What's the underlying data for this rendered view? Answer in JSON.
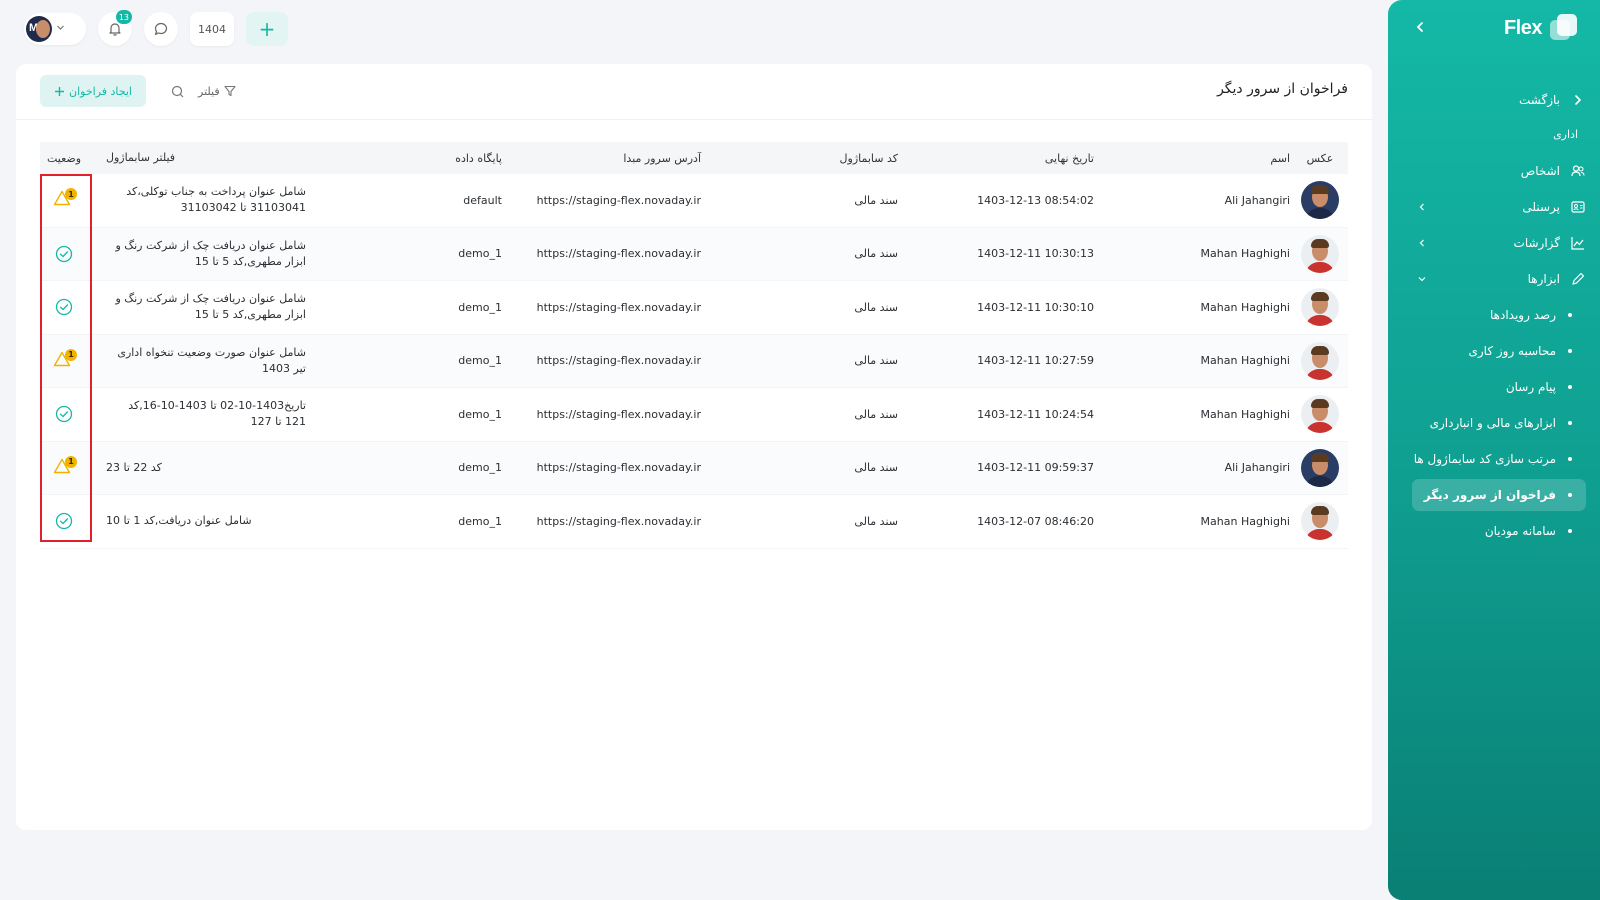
{
  "sidebar": {
    "brand": "Flex",
    "back_label": "بازگشت",
    "section_label": "اداری",
    "items": [
      {
        "label": "اشخاص",
        "icon": "people-icon"
      },
      {
        "label": "پرسنلی",
        "icon": "id-card-icon"
      },
      {
        "label": "گزارشات",
        "icon": "chart-icon"
      },
      {
        "label": "ابزارها",
        "icon": "pencil-icon"
      }
    ],
    "subitems": [
      {
        "label": "رصد رویدادها"
      },
      {
        "label": "محاسبه روز کاری"
      },
      {
        "label": "پیام رسان"
      },
      {
        "label": "ابزارهای مالی و انبارداری"
      },
      {
        "label": "مرتب سازی کد سابماژول ها"
      },
      {
        "label": "فراخوان از سرور دیگر",
        "active": true
      },
      {
        "label": "سامانه موديان"
      }
    ]
  },
  "topbar": {
    "notifications_count": "13",
    "year": "1404",
    "add_label": "+"
  },
  "page": {
    "title": "فراخوان از سرور دیگر",
    "create_button": "ایجاد فراخوان",
    "filter_label": "فیلتر"
  },
  "table": {
    "headers": {
      "photo": "عکس",
      "name": "اسم",
      "date": "تاریخ نهایی",
      "code": "کد سابماژول",
      "url": "آدرس سرور مبدا",
      "db": "پایگاه داده",
      "filter": "فیلتر سابماژول",
      "status": "وضعیت"
    },
    "rows": [
      {
        "name": "Ali Jahangiri",
        "date": "1403-12-13 08:54:02",
        "code": "سند مالی",
        "url": "https://staging-flex.novaday.ir",
        "db": "default",
        "filter": "شامل عنوان پرداخت به جناب توکلی،کد 31103041 تا 31103042",
        "status": "warning",
        "status_count": "1"
      },
      {
        "name": "Mahan Haghighi",
        "date": "1403-12-11 10:30:13",
        "code": "سند مالی",
        "url": "https://staging-flex.novaday.ir",
        "db": "demo_1",
        "filter": "شامل عنوان دریافت چک از شرکت رنگ و ابزار مطهری,کد 5 تا 15",
        "status": "success",
        "status_count": ""
      },
      {
        "name": "Mahan Haghighi",
        "date": "1403-12-11 10:30:10",
        "code": "سند مالی",
        "url": "https://staging-flex.novaday.ir",
        "db": "demo_1",
        "filter": "شامل عنوان دریافت چک از شرکت رنگ و ابزار مطهری,کد 5 تا 15",
        "status": "success",
        "status_count": ""
      },
      {
        "name": "Mahan Haghighi",
        "date": "1403-12-11 10:27:59",
        "code": "سند مالی",
        "url": "https://staging-flex.novaday.ir",
        "db": "demo_1",
        "filter": "شامل عنوان صورت وضعیت تنخواه اداری تیر 1403",
        "status": "warning",
        "status_count": "1"
      },
      {
        "name": "Mahan Haghighi",
        "date": "1403-12-11 10:24:54",
        "code": "سند مالی",
        "url": "https://staging-flex.novaday.ir",
        "db": "demo_1",
        "filter": "تاریخ1403-10-02 تا 1403-10-16,کد 121 تا 127",
        "status": "success",
        "status_count": ""
      },
      {
        "name": "Ali Jahangiri",
        "date": "1403-12-11 09:59:37",
        "code": "سند مالی",
        "url": "https://staging-flex.novaday.ir",
        "db": "demo_1",
        "filter": "کد 22 تا 23",
        "status": "warning",
        "status_count": "1"
      },
      {
        "name": "Mahan Haghighi",
        "date": "1403-12-07 08:46:20",
        "code": "سند مالی",
        "url": "https://staging-flex.novaday.ir",
        "db": "demo_1",
        "filter": "شامل عنوان دریافت,کد 1 تا 10",
        "status": "success",
        "status_count": ""
      }
    ]
  },
  "colors": {
    "accent": "#14b8a6",
    "warning": "#f0b400",
    "highlight": "#e0202a"
  }
}
